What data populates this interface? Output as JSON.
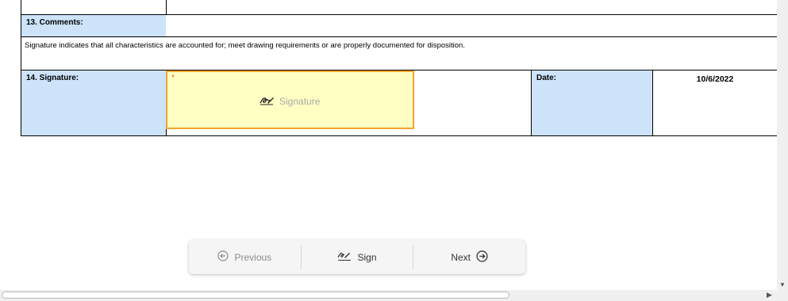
{
  "form": {
    "comments_label": "13. Comments:",
    "comments_value": "",
    "notice": "Signature indicates that all characteristics are accounted for; meet drawing requirements or are properly documented for disposition.",
    "signature_label": "14. Signature:",
    "signature_required_marker": "*",
    "signature_placeholder": "Signature",
    "date_label": "Date:",
    "date_value": "10/6/2022"
  },
  "navigation": {
    "previous_label": "Previous",
    "sign_label": "Sign",
    "next_label": "Next"
  },
  "colors": {
    "label_background": "#cce3f9",
    "signature_field_background": "#ffffc4",
    "signature_field_border": "#f2a52f"
  }
}
